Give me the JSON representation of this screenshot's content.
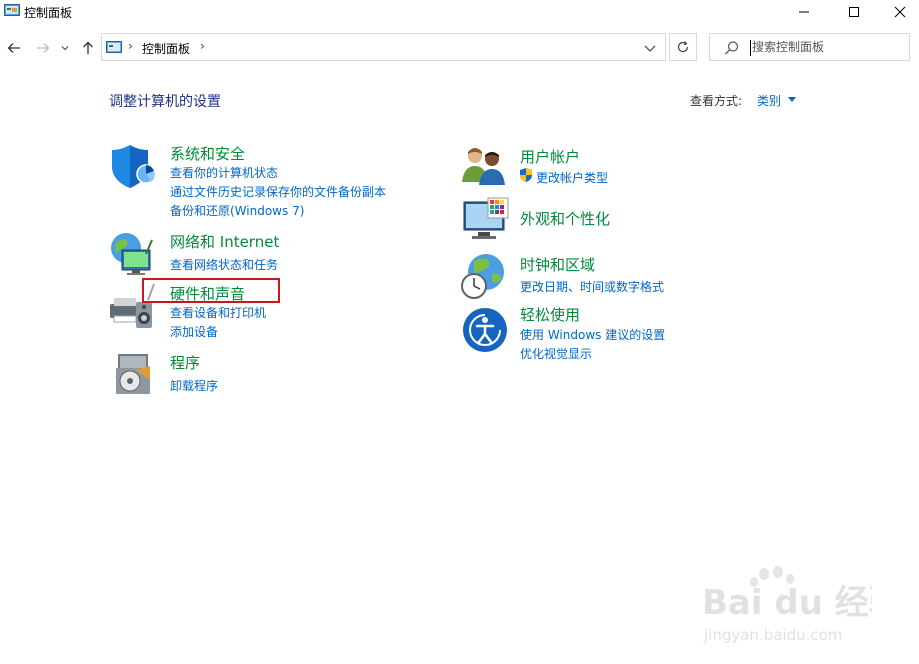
{
  "window": {
    "title": "控制面板"
  },
  "address_bar": {
    "path": "控制面板"
  },
  "search": {
    "placeholder": "搜索控制面板"
  },
  "main": {
    "heading": "调整计算机的设置",
    "view_by_label": "查看方式:",
    "view_by_value": "类别"
  },
  "categories_left": [
    {
      "title": "系统和安全",
      "links": [
        "查看你的计算机状态",
        "通过文件历史记录保存你的文件备份副本",
        "备份和还原(Windows 7)"
      ]
    },
    {
      "title": "网络和 Internet",
      "links": [
        "查看网络状态和任务"
      ]
    },
    {
      "title": "硬件和声音",
      "links": [
        "查看设备和打印机",
        "添加设备"
      ]
    },
    {
      "title": "程序",
      "links": [
        "卸载程序"
      ]
    }
  ],
  "categories_right": [
    {
      "title": "用户帐户",
      "links": [
        "更改帐户类型"
      ]
    },
    {
      "title": "外观和个性化",
      "links": []
    },
    {
      "title": "时钟和区域",
      "links": [
        "更改日期、时间或数字格式"
      ]
    },
    {
      "title": "轻松使用",
      "links": [
        "使用 Windows 建议的设置",
        "优化视觉显示"
      ]
    }
  ],
  "watermark": {
    "brand": "Bai du 经验",
    "site": "jingyan.baidu.com"
  },
  "colors": {
    "accent_link": "#0066cc",
    "category_title": "#008a3a",
    "heading": "#1e3287",
    "highlight_box": "#c8171e"
  }
}
